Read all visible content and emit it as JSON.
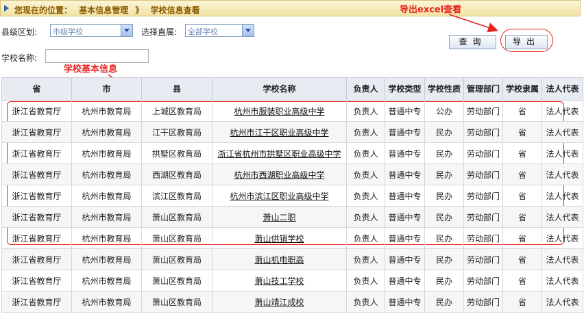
{
  "breadcrumb": {
    "prefix": "您现在的位置：",
    "level1": "基本信息管理",
    "separator": "》",
    "level2": "学校信息查看"
  },
  "filters": {
    "county_label": "县级区划:",
    "county_value": "市级学校",
    "affiliation_label": "选择直属:",
    "affiliation_value": "全部学校",
    "school_name_label": "学校名称:",
    "school_name_value": ""
  },
  "buttons": {
    "query": "查询",
    "export": "导出"
  },
  "annotations": {
    "export_note": "导出excel查看",
    "table_note": "学校基本信息"
  },
  "annotation_color": "#e8221c",
  "table": {
    "headers": [
      "省",
      "市",
      "县",
      "学校名称",
      "负责人",
      "学校类型",
      "学校性质",
      "管理部门",
      "学校隶属",
      "法人代表"
    ],
    "rows": [
      [
        "浙江省教育厅",
        "杭州市教育局",
        "上城区教育局",
        "杭州市服装职业高级中学",
        "负责人",
        "普通中专",
        "公办",
        "劳动部门",
        "省",
        "法人代表"
      ],
      [
        "浙江省教育厅",
        "杭州市教育局",
        "江干区教育局",
        "杭州市江干区职业高级中学",
        "负责人",
        "普通中专",
        "民办",
        "劳动部门",
        "省",
        "法人代表"
      ],
      [
        "浙江省教育厅",
        "杭州市教育局",
        "拱墅区教育局",
        "浙江省杭州市拱墅区职业高级中学",
        "负责人",
        "普通中专",
        "民办",
        "劳动部门",
        "省",
        "法人代表"
      ],
      [
        "浙江省教育厅",
        "杭州市教育局",
        "西湖区教育局",
        "杭州市西湖职业高级中学",
        "负责人",
        "普通中专",
        "民办",
        "劳动部门",
        "省",
        "法人代表"
      ],
      [
        "浙江省教育厅",
        "杭州市教育局",
        "滨江区教育局",
        "杭州市滨江区职业高级中学",
        "负责人",
        "普通中专",
        "民办",
        "劳动部门",
        "省",
        "法人代表"
      ],
      [
        "浙江省教育厅",
        "杭州市教育局",
        "萧山区教育局",
        "萧山二职",
        "负责人",
        "普通中专",
        "民办",
        "劳动部门",
        "省",
        "法人代表"
      ],
      [
        "浙江省教育厅",
        "杭州市教育局",
        "萧山区教育局",
        "萧山供销学校",
        "负责人",
        "普通中专",
        "民办",
        "劳动部门",
        "省",
        "法人代表"
      ],
      [
        "浙江省教育厅",
        "杭州市教育局",
        "萧山区教育局",
        "萧山机电职高",
        "负责人",
        "普通中专",
        "民办",
        "劳动部门",
        "省",
        "法人代表"
      ],
      [
        "浙江省教育厅",
        "杭州市教育局",
        "萧山区教育局",
        "萧山技工学校",
        "负责人",
        "普通中专",
        "民办",
        "劳动部门",
        "省",
        "法人代表"
      ],
      [
        "浙江省教育厅",
        "杭州市教育局",
        "萧山区教育局",
        "萧山靖江成校",
        "负责人",
        "普通中专",
        "民办",
        "劳动部门",
        "省",
        "法人代表"
      ]
    ]
  }
}
